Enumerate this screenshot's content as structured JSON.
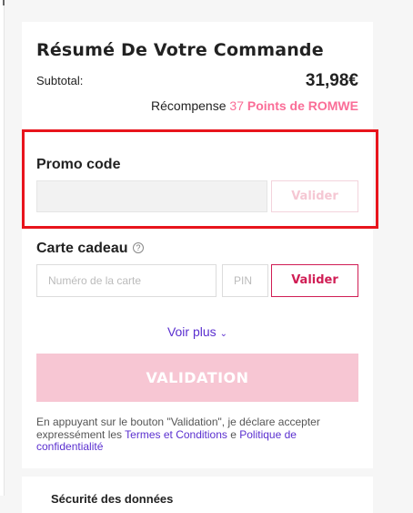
{
  "summary": {
    "title": "Résumé De Votre Commande",
    "subtotal_label": "Subtotal:",
    "subtotal_value": "31,98€",
    "reward_prefix": "Récompense",
    "reward_points": "37",
    "reward_suffix": "Points de ROMWE"
  },
  "promo": {
    "title": "Promo code",
    "input_value": "",
    "button_label": "Valider"
  },
  "gift_card": {
    "title": "Carte cadeau",
    "help_icon": "?",
    "card_placeholder": "Numéro de la carte",
    "pin_placeholder": "PIN",
    "button_label": "Valider"
  },
  "more": {
    "label": "Voir plus",
    "chevron": "⌄"
  },
  "checkout": {
    "button_label": "VALIDATION"
  },
  "legal": {
    "text_prefix": "En appuyant sur le bouton \"Validation\", je déclare accepter expressément les ",
    "terms_link": "Termes et Conditions",
    "conjunction": " e ",
    "privacy_link": "Politique de confidentialité"
  },
  "next_card": {
    "title": "Sécurité des données"
  },
  "colors": {
    "accent_pink": "#fa6d97",
    "button_border": "#d01e55",
    "link_purple": "#5a2fcf",
    "highlight_red": "#e8141c",
    "disabled_pink": "#f7c6d3"
  }
}
